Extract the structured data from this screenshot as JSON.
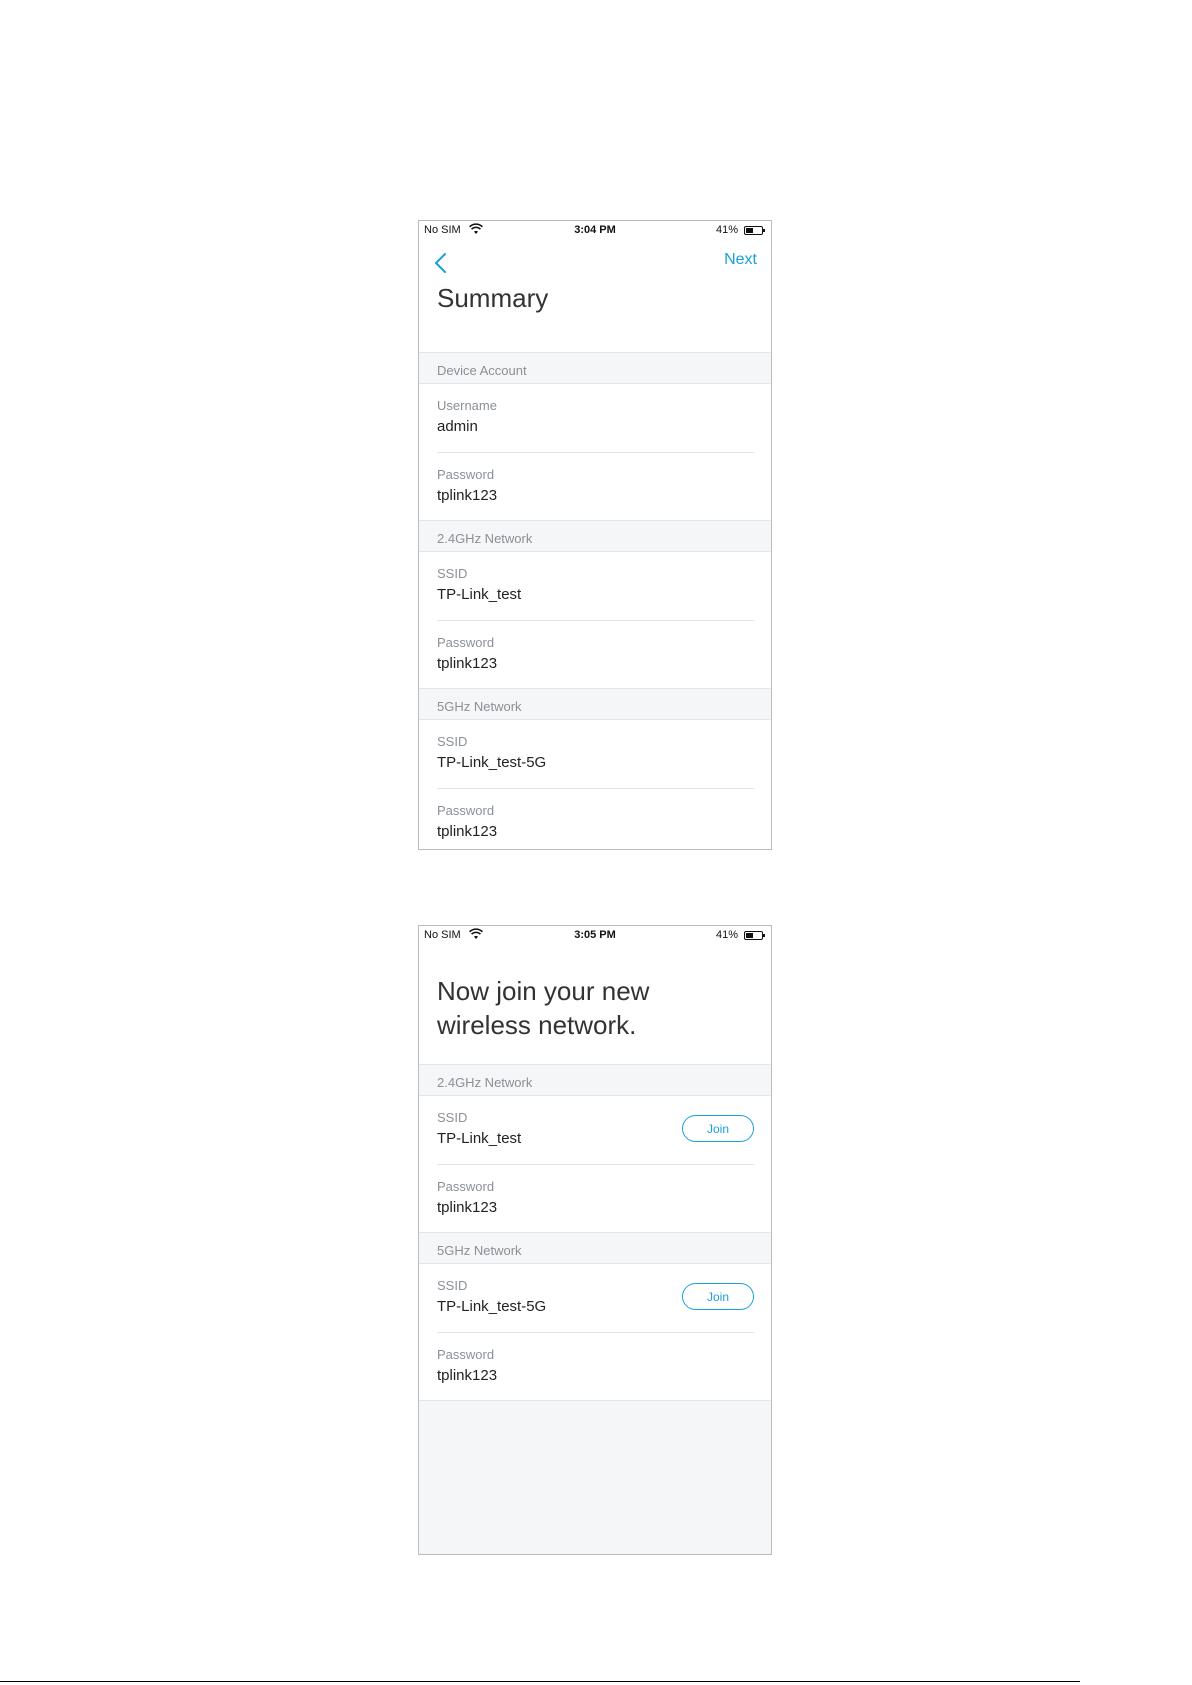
{
  "screens": [
    {
      "status": {
        "carrier": "No SIM",
        "time": "3:04 PM",
        "battery": "41%"
      },
      "nav": {
        "next_label": "Next"
      },
      "title": "Summary",
      "sections": [
        {
          "header": "Device Account",
          "fields": [
            {
              "label": "Username",
              "value": "admin"
            },
            {
              "label": "Password",
              "value": "tplink123"
            }
          ]
        },
        {
          "header": "2.4GHz Network",
          "fields": [
            {
              "label": "SSID",
              "value": "TP-Link_test"
            },
            {
              "label": "Password",
              "value": "tplink123"
            }
          ]
        },
        {
          "header": "5GHz Network",
          "fields": [
            {
              "label": "SSID",
              "value": "TP-Link_test-5G"
            },
            {
              "label": "Password",
              "value": "tplink123"
            }
          ]
        }
      ]
    },
    {
      "status": {
        "carrier": "No SIM",
        "time": "3:05 PM",
        "battery": "41%"
      },
      "title_line1": "Now join your new",
      "title_line2": "wireless network.",
      "join_label": "Join",
      "sections": [
        {
          "header": "2.4GHz Network",
          "fields": [
            {
              "label": "SSID",
              "value": "TP-Link_test"
            },
            {
              "label": "Password",
              "value": "tplink123"
            }
          ]
        },
        {
          "header": "5GHz Network",
          "fields": [
            {
              "label": "SSID",
              "value": "TP-Link_test-5G"
            },
            {
              "label": "Password",
              "value": "tplink123"
            }
          ]
        }
      ]
    }
  ],
  "colors": {
    "accent": "#1aa0d8",
    "section_bg": "#f4f6f8",
    "label": "#8a9097"
  }
}
